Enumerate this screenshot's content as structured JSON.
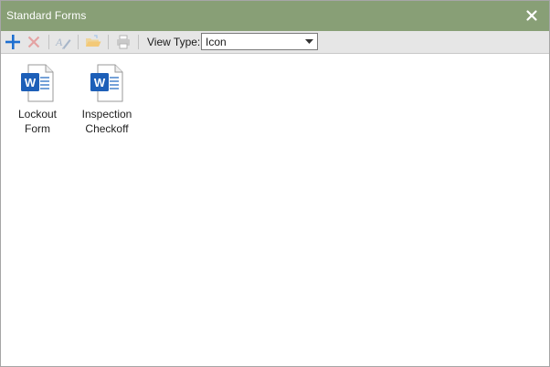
{
  "window": {
    "title": "Standard Forms",
    "titlebar_color": "#889f76"
  },
  "toolbar": {
    "buttons": [
      {
        "icon": "plus-icon",
        "state": "enabled"
      },
      {
        "icon": "delete-x-icon",
        "state": "disabled"
      },
      {
        "icon": "rename-icon",
        "state": "disabled"
      },
      {
        "icon": "open-folder-icon",
        "state": "disabled"
      },
      {
        "icon": "print-icon",
        "state": "disabled"
      }
    ],
    "view_type_label": "View Type:",
    "view_type_value": "Icon"
  },
  "files": [
    {
      "label": "Lockout\nForm",
      "icon": "word-document-icon"
    },
    {
      "label": "Inspection\nCheckoff",
      "icon": "word-document-icon"
    }
  ]
}
